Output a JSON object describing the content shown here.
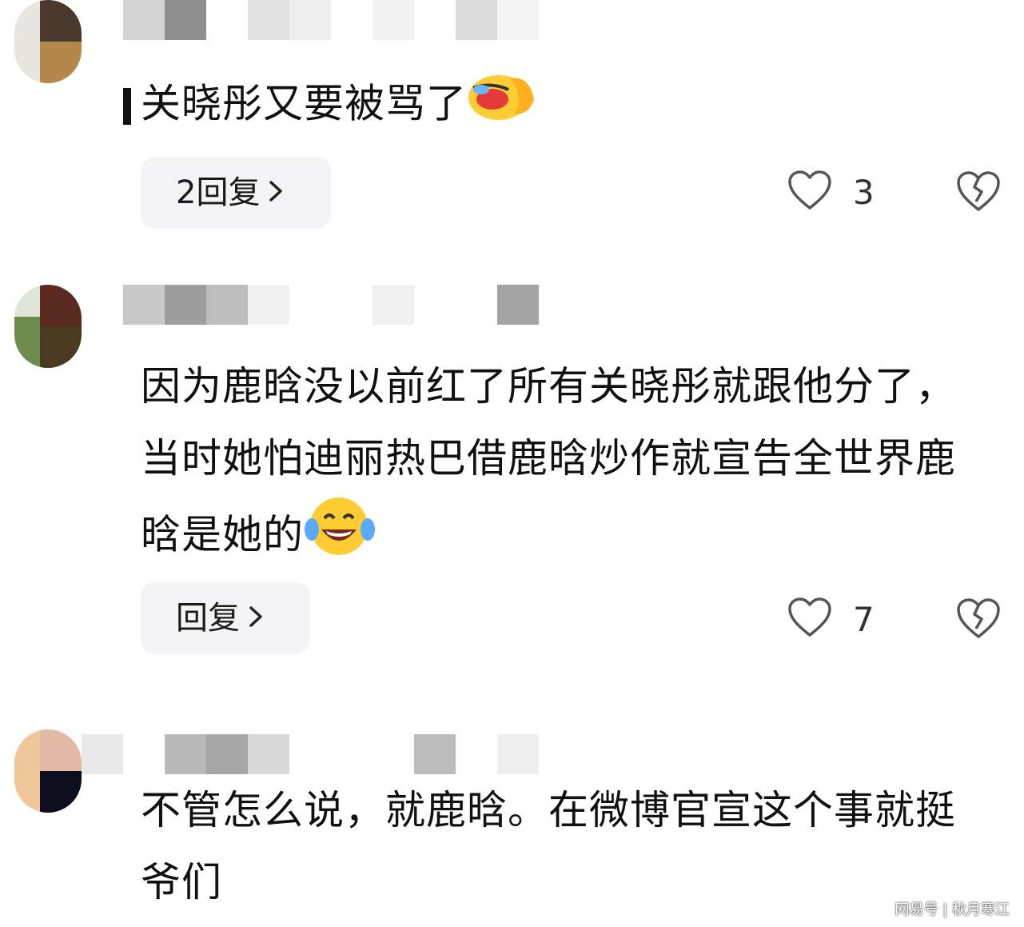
{
  "comments": [
    {
      "text": "关晓彤又要被骂了",
      "emoji": "crying-laughing-face-icon",
      "reply_label": "2回复",
      "likes": "3"
    },
    {
      "text": "因为鹿晗没以前红了所有关晓彤就跟他分了，当时她怕迪丽热巴借鹿晗炒作就宣告全世界鹿晗是她的",
      "emoji": "tears-of-joy-icon",
      "reply_label": "回复",
      "likes": "7"
    },
    {
      "text": "不管怎么说，就鹿晗。在微博官宣这个事就挺爷们"
    }
  ],
  "watermark": "网易号 | 秋月寒江",
  "colors": {
    "reply_bg": "#f4f4f6",
    "icon_stroke": "#555555",
    "emoji_yellow": "#ffcc33"
  }
}
